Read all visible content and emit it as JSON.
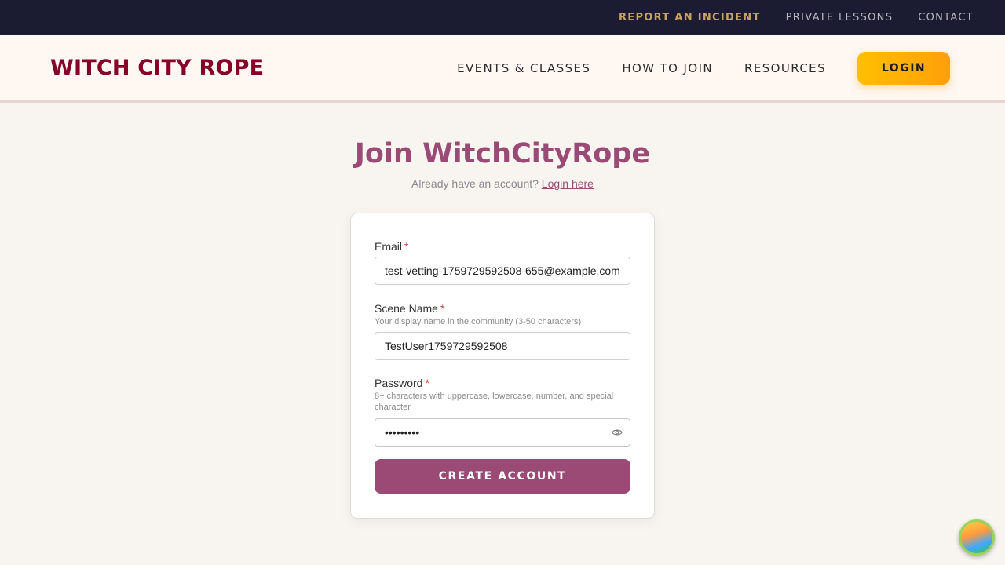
{
  "topbar": {
    "links": [
      "REPORT AN INCIDENT",
      "PRIVATE LESSONS",
      "CONTACT"
    ]
  },
  "header": {
    "logo": "WITCH CITY ROPE",
    "nav": [
      "EVENTS & CLASSES",
      "HOW TO JOIN",
      "RESOURCES"
    ],
    "login": "LOGIN"
  },
  "page": {
    "title": "Join WitchCityRope",
    "subtitle_text": "Already have an account?",
    "login_link": "Login here"
  },
  "form": {
    "email": {
      "label": "Email",
      "required": "*",
      "value": "test-vetting-1759729592508-655@example.com"
    },
    "scene_name": {
      "label": "Scene Name",
      "required": "*",
      "hint": "Your display name in the community (3-50 characters)",
      "value": "TestUser1759729592508"
    },
    "password": {
      "label": "Password",
      "required": "*",
      "hint": "8+ characters with uppercase, lowercase, number, and special character",
      "value": "•••••••••"
    },
    "submit": "CREATE ACCOUNT"
  },
  "icons": {
    "eye": "eye-icon",
    "helper": "assistant-avatar-icon"
  },
  "colors": {
    "topbar_bg": "#1b1c32",
    "incident": "#c9a45c",
    "brand": "#880124",
    "accent": "#9b4a75",
    "login_btn": "#ffb300"
  }
}
